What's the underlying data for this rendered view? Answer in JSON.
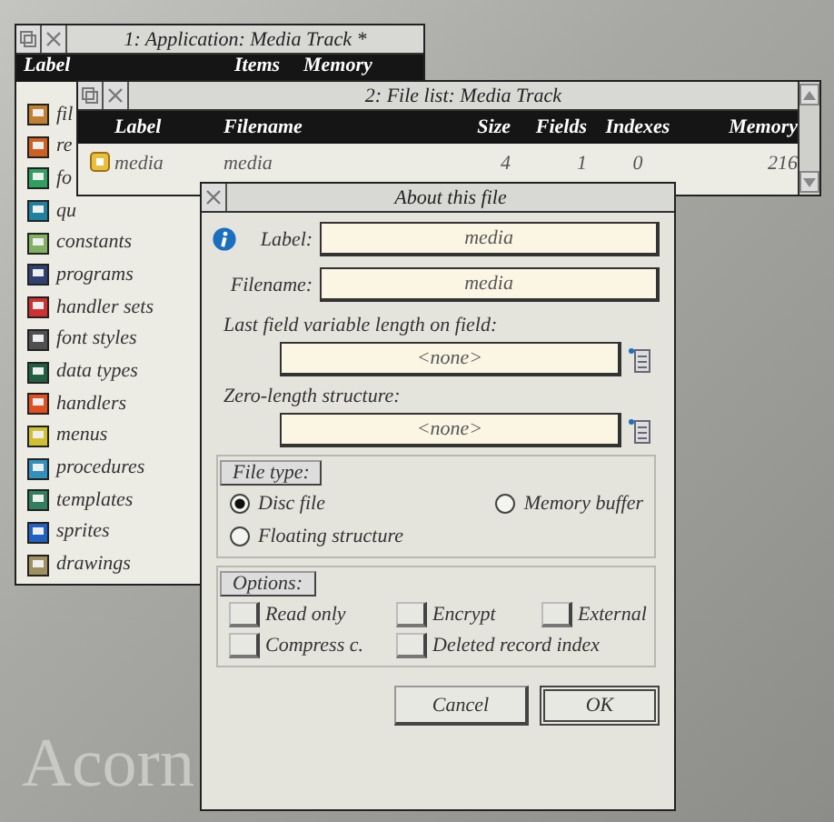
{
  "backdrop": {
    "text": "Acorn"
  },
  "app_window": {
    "title": "1: Application: Media Track *",
    "columns": [
      "Label",
      "Items",
      "Memory"
    ],
    "items": [
      {
        "label": "fil",
        "color": "#c08030"
      },
      {
        "label": "re",
        "color": "#d06020"
      },
      {
        "label": "fo",
        "color": "#30a060"
      },
      {
        "label": "qu",
        "color": "#2080a0"
      },
      {
        "label": "constants",
        "color": "#80b060"
      },
      {
        "label": "programs",
        "color": "#304070"
      },
      {
        "label": "handler sets",
        "color": "#d03030"
      },
      {
        "label": "font styles",
        "color": "#505050"
      },
      {
        "label": "data types",
        "color": "#206040"
      },
      {
        "label": "handlers",
        "color": "#e05020"
      },
      {
        "label": "menus",
        "color": "#d0c030"
      },
      {
        "label": "procedures",
        "color": "#3090c0"
      },
      {
        "label": "templates",
        "color": "#308060"
      },
      {
        "label": "sprites",
        "color": "#2060c0"
      },
      {
        "label": "drawings",
        "color": "#a09060"
      }
    ]
  },
  "file_list_window": {
    "title": "2: File list: Media Track",
    "columns": [
      "Label",
      "Filename",
      "Size",
      "Fields",
      "Indexes",
      "Memory"
    ],
    "rows": [
      {
        "label": "media",
        "filename": "media",
        "size": "4",
        "fields": "1",
        "indexes": "0",
        "memory": "216"
      }
    ]
  },
  "about_dialog": {
    "title": "About this file",
    "label_field": {
      "label": "Label:",
      "value": "media"
    },
    "filename_field": {
      "label": "Filename:",
      "value": "media"
    },
    "last_field": {
      "label": "Last field variable length on field:",
      "value": "<none>"
    },
    "zero_length": {
      "label": "Zero-length structure:",
      "value": "<none>"
    },
    "file_type": {
      "label": "File type:",
      "options": [
        {
          "label": "Disc file",
          "selected": true
        },
        {
          "label": "Memory buffer",
          "selected": false
        },
        {
          "label": "Floating structure",
          "selected": false
        }
      ]
    },
    "options": {
      "label": "Options:",
      "items": [
        {
          "label": "Read only",
          "checked": false
        },
        {
          "label": "Encrypt",
          "checked": false
        },
        {
          "label": "External",
          "checked": false
        },
        {
          "label": "Compress c.",
          "checked": false
        },
        {
          "label": "Deleted record index",
          "checked": false
        }
      ]
    },
    "buttons": [
      {
        "label": "Cancel",
        "default": false
      },
      {
        "label": "OK",
        "default": true
      }
    ]
  }
}
